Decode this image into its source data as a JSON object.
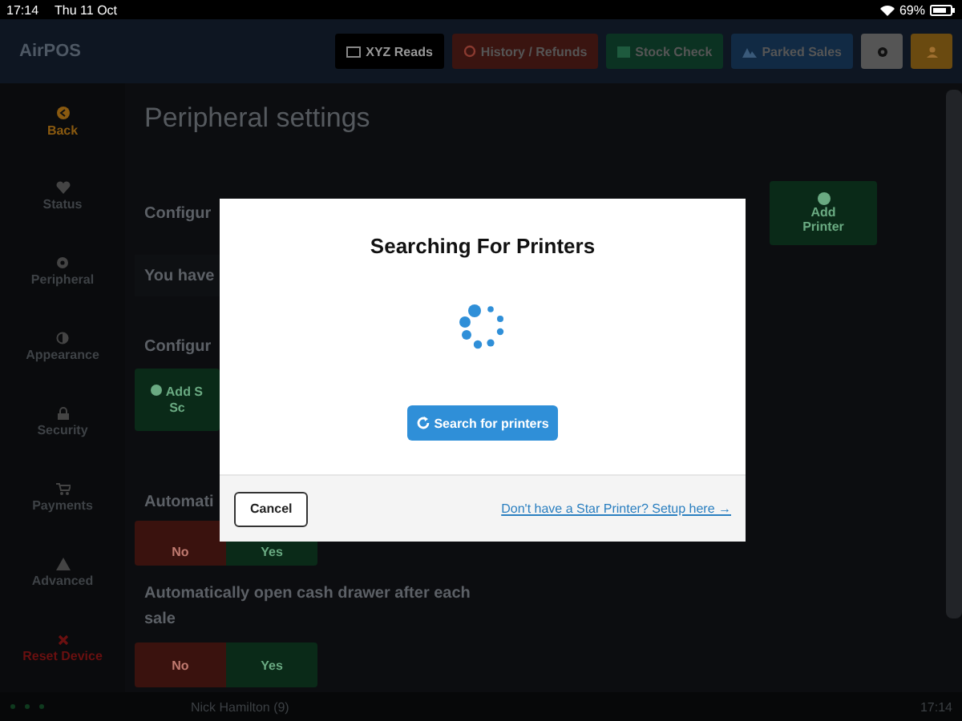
{
  "status_bar": {
    "time": "17:14",
    "date": "Thu 11 Oct",
    "battery": "69%"
  },
  "header": {
    "brand": "AirPOS",
    "buttons": [
      {
        "kind": "reads",
        "label": "XYZ Reads"
      },
      {
        "kind": "history",
        "label": "History / Refunds"
      },
      {
        "kind": "stock",
        "label": "Stock Check"
      },
      {
        "kind": "parked",
        "label": "Parked Sales"
      },
      {
        "kind": "settings"
      },
      {
        "kind": "user"
      }
    ]
  },
  "sidebar": {
    "items": [
      {
        "kind": "back",
        "label": "Back"
      },
      {
        "kind": "status",
        "label": "Status"
      },
      {
        "kind": "peripheral",
        "label": "Peripheral"
      },
      {
        "kind": "appearance",
        "label": "Appearance"
      },
      {
        "kind": "security",
        "label": "Security"
      },
      {
        "kind": "payments",
        "label": "Payments"
      },
      {
        "kind": "advanced",
        "label": "Advanced"
      },
      {
        "kind": "reset",
        "label": "Reset Device"
      }
    ]
  },
  "page": {
    "title": "Peripheral settings",
    "printers": {
      "heading": "Configur",
      "add_button": "Add Printer"
    },
    "notice": "You have",
    "scanners": {
      "heading": "Configur",
      "add_button_lines": [
        "Add S",
        "Sc"
      ]
    },
    "settings": [
      {
        "question": "Automati",
        "options": [
          {
            "kind": "no",
            "label": "No"
          },
          {
            "kind": "yes",
            "label": "Yes"
          }
        ]
      },
      {
        "question": "Automatically open cash drawer after each sale",
        "options": [
          {
            "kind": "no",
            "label": "No"
          },
          {
            "kind": "yes",
            "label": "Yes"
          }
        ]
      }
    ]
  },
  "footer": {
    "user": "Nick Hamilton (9)",
    "time": "17:14"
  },
  "modal": {
    "title": "Searching For Printers",
    "search_button": "Search for printers",
    "cancel_button": "Cancel",
    "link": "Don't have a Star Printer? Setup here →"
  }
}
